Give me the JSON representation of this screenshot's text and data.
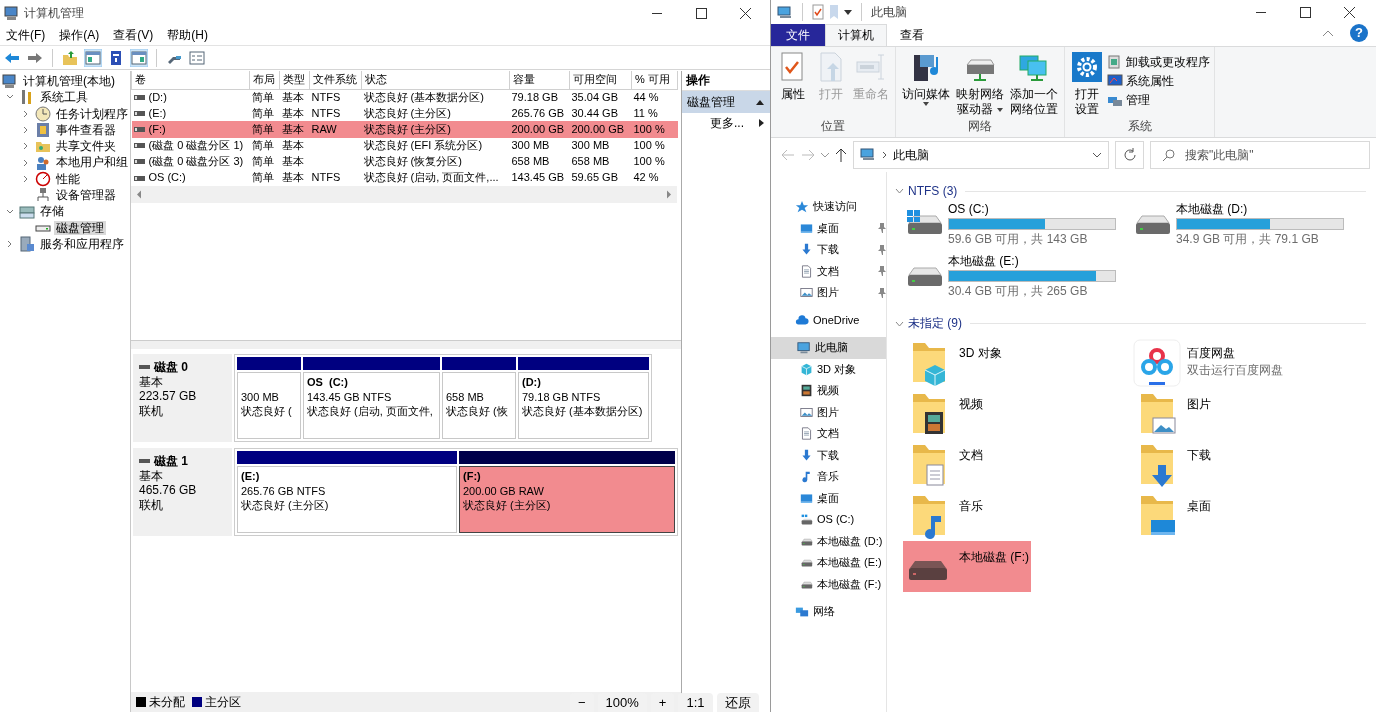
{
  "computer_management": {
    "title": "计算机管理",
    "menu": [
      "文件(F)",
      "操作(A)",
      "查看(V)",
      "帮助(H)"
    ],
    "toolbar": [
      {
        "pressed": false
      },
      {
        "pressed": false
      },
      {
        "pressed": false
      },
      {
        "pressed": true
      },
      {
        "pressed": false
      },
      {
        "pressed": true
      },
      {
        "pressed": false
      },
      {
        "pressed": false
      }
    ],
    "tree": [
      {
        "label": "计算机管理(本地)",
        "selected": false,
        "children": [
          {
            "label": "系统工具",
            "expanded": true,
            "selected": false,
            "children": [
              {
                "label": "任务计划程序",
                "expanded": false,
                "selected": false
              },
              {
                "label": "事件查看器",
                "expanded": false,
                "selected": false
              },
              {
                "label": "共享文件夹",
                "expanded": false,
                "selected": false
              },
              {
                "label": "本地用户和组",
                "expanded": false,
                "selected": false
              },
              {
                "label": "性能",
                "expanded": false,
                "selected": false
              },
              {
                "label": "设备管理器",
                "selected": false
              }
            ]
          },
          {
            "label": "存储",
            "expanded": true,
            "selected": false,
            "children": [
              {
                "label": "磁盘管理",
                "selected": true
              }
            ]
          },
          {
            "label": "服务和应用程序",
            "expanded": false,
            "selected": false
          }
        ]
      }
    ],
    "table": {
      "columns": [
        "卷",
        "布局",
        "类型",
        "文件系统",
        "状态",
        "容量",
        "可用空间",
        "% 可用"
      ],
      "rows": [
        {
          "cells": [
            "(D:)",
            "简单",
            "基本",
            "NTFS",
            "状态良好 (基本数据分区)",
            "79.18 GB",
            "35.04 GB",
            "44 %"
          ],
          "selected": false
        },
        {
          "cells": [
            "(E:)",
            "简单",
            "基本",
            "NTFS",
            "状态良好 (主分区)",
            "265.76 GB",
            "30.44 GB",
            "11 %"
          ],
          "selected": false
        },
        {
          "cells": [
            "(F:)",
            "简单",
            "基本",
            "RAW",
            "状态良好 (主分区)",
            "200.00 GB",
            "200.00 GB",
            "100 %"
          ],
          "selected": true
        },
        {
          "cells": [
            "(磁盘 0 磁盘分区 1)",
            "简单",
            "基本",
            null,
            "状态良好 (EFI 系统分区)",
            "300 MB",
            "300 MB",
            "100 %"
          ],
          "selected": false
        },
        {
          "cells": [
            "(磁盘 0 磁盘分区 3)",
            "简单",
            "基本",
            null,
            "状态良好 (恢复分区)",
            "658 MB",
            "658 MB",
            "100 %"
          ],
          "selected": false
        },
        {
          "cells": [
            "OS (C:)",
            "简单",
            "基本",
            "NTFS",
            "状态良好 (启动, 页面文件,...",
            "143.45 GB",
            "59.65 GB",
            "42 %"
          ],
          "selected": false
        }
      ]
    },
    "disks": [
      {
        "name": "磁盘 0",
        "type": "基本",
        "size": "223.57 GB",
        "status": "联机",
        "partitions": [
          {
            "size_fs": "300 MB",
            "status": "状态良好 (",
            "selected": false
          },
          {
            "label": "OS  (C:)",
            "size_fs": "143.45 GB NTFS",
            "status": "状态良好 (启动, 页面文件,",
            "selected": false
          },
          {
            "size_fs": "658 MB",
            "status": "状态良好 (恢",
            "selected": false
          },
          {
            "label": "(D:)",
            "size_fs": "79.18 GB NTFS",
            "status": "状态良好 (基本数据分区)",
            "selected": false
          }
        ]
      },
      {
        "name": "磁盘 1",
        "type": "基本",
        "size": "465.76 GB",
        "status": "联机",
        "partitions": [
          {
            "label": "(E:)",
            "size_fs": "265.76 GB NTFS",
            "status": "状态良好 (主分区)",
            "selected": false
          },
          {
            "label": "(F:)",
            "size_fs": "200.00 GB RAW",
            "status": "状态良好 (主分区)",
            "selected": true
          }
        ]
      }
    ],
    "legend": [
      {
        "label": "未分配",
        "color": "#000000"
      },
      {
        "label": "主分区",
        "color": "#000080"
      }
    ],
    "actions": {
      "title": "操作",
      "section": "磁盘管理",
      "more": "更多..."
    }
  },
  "zoom_bar": [
    "−",
    "100%",
    "+",
    "1:1",
    "还原"
  ],
  "explorer": {
    "title": "此电脑",
    "ribbon_tabs": [
      {
        "label": "文件",
        "kind": "file",
        "selected": false
      },
      {
        "label": "计算机",
        "kind": "tab",
        "selected": true
      },
      {
        "label": "查看",
        "kind": "tab",
        "selected": false
      }
    ],
    "help": "?",
    "ribbon_groups": [
      {
        "name": "位置",
        "items": [
          {
            "kind": "large",
            "lines": [
              "属性"
            ],
            "disabled": false,
            "dropdown": false
          },
          {
            "kind": "large",
            "lines": [
              "打开"
            ],
            "disabled": true,
            "dropdown": false
          },
          {
            "kind": "large",
            "lines": [
              "重命名"
            ],
            "disabled": true,
            "dropdown": false
          }
        ]
      },
      {
        "name": "网络",
        "items": [
          {
            "kind": "large",
            "lines": [
              "访问媒体"
            ],
            "disabled": false,
            "dropdown": true
          },
          {
            "kind": "large",
            "lines": [
              "映射网络",
              "驱动器"
            ],
            "disabled": false,
            "dropdown": true
          },
          {
            "kind": "large",
            "lines": [
              "添加一个",
              "网络位置"
            ],
            "disabled": false,
            "dropdown": false
          }
        ]
      },
      {
        "name": "系统",
        "items": [
          {
            "kind": "large",
            "lines": [
              "打开",
              "设置"
            ],
            "disabled": false,
            "dropdown": false
          },
          {
            "kind": "small",
            "lines": [
              "卸载或更改程序"
            ],
            "disabled": false
          },
          {
            "kind": "small",
            "lines": [
              "系统属性"
            ],
            "disabled": false
          },
          {
            "kind": "small",
            "lines": [
              "管理"
            ],
            "disabled": false
          }
        ]
      }
    ],
    "address": {
      "path": "此电脑",
      "search_placeholder": "搜索\"此电脑\""
    },
    "nav": [
      {
        "label": "快速访问",
        "selected": false,
        "children": [
          {
            "label": "桌面",
            "pinned": true,
            "selected": false
          },
          {
            "label": "下载",
            "pinned": true,
            "selected": false
          },
          {
            "label": "文档",
            "pinned": true,
            "selected": false
          },
          {
            "label": "图片",
            "pinned": true,
            "selected": false
          }
        ]
      },
      {
        "label": "OneDrive",
        "selected": false
      },
      {
        "label": "此电脑",
        "selected": true,
        "children": [
          {
            "label": "3D 对象",
            "selected": false
          },
          {
            "label": "视频",
            "selected": false
          },
          {
            "label": "图片",
            "selected": false
          },
          {
            "label": "文档",
            "selected": false
          },
          {
            "label": "下载",
            "selected": false
          },
          {
            "label": "音乐",
            "selected": false
          },
          {
            "label": "桌面",
            "selected": false
          },
          {
            "label": "OS (C:)",
            "selected": false
          },
          {
            "label": "本地磁盘 (D:)",
            "selected": false
          },
          {
            "label": "本地磁盘 (E:)",
            "selected": false
          },
          {
            "label": "本地磁盘 (F:)",
            "selected": false
          }
        ]
      },
      {
        "label": "网络",
        "selected": false
      }
    ],
    "groups": [
      {
        "title": "NTFS (3)",
        "expanded": true,
        "kind": "drives",
        "items": [
          {
            "name": "OS (C:)",
            "level": 0.58,
            "free": "59.6 GB 可用，共 143 GB",
            "selected": false
          },
          {
            "name": "本地磁盘 (D:)",
            "level": 0.56,
            "free": "34.9 GB 可用，共 79.1 GB",
            "selected": false
          },
          {
            "name": "本地磁盘 (E:)",
            "level": 0.885,
            "free": "30.4 GB 可用，共 265 GB",
            "selected": false
          }
        ]
      },
      {
        "title": "未指定 (9)",
        "expanded": true,
        "kind": "tiles",
        "items": [
          {
            "name": "3D 对象",
            "selected": false
          },
          {
            "name": "百度网盘",
            "subtitle": "双击运行百度网盘",
            "selected": false
          },
          {
            "name": "视频",
            "selected": false
          },
          {
            "name": "图片",
            "selected": false
          },
          {
            "name": "文档",
            "selected": false
          },
          {
            "name": "下载",
            "selected": false
          },
          {
            "name": "音乐",
            "selected": false
          },
          {
            "name": "桌面",
            "selected": false
          },
          {
            "name": "本地磁盘 (F:)",
            "selected": true
          }
        ]
      }
    ]
  }
}
